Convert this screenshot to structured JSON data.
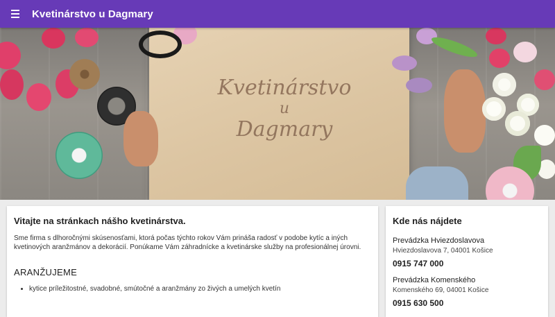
{
  "appbar": {
    "title": "Kvetinárstvo u Dagmary",
    "menu_icon": "menu-icon"
  },
  "hero": {
    "script_line1": "Kvetinárstvo",
    "script_line2": "u",
    "script_line3": "Dagmary",
    "scroll_icon": "mouse-scroll-icon"
  },
  "main": {
    "heading": "Vitajte na stránkach nášho kvetinárstva.",
    "intro": "Sme firma s dlhoročnými skúsenosťami, ktorá počas týchto rokov Vám prináša radosť v podobe kytíc a iných kvetinových aranžmánov a dekorácií. Ponúkame Vám záhradnícke a kvetinárske služby na profesionálnej úrovni.",
    "section_title": "ARANŽUJEME",
    "items": [
      "kytice príležitostné, svadobné, smútočné a aranžmány zo živých a umelých kvetín"
    ]
  },
  "contact": {
    "heading": "Kde nás nájdete",
    "branches": [
      {
        "name": "Prevádzka Hviezdoslavova",
        "address": "Hviezdoslavova 7, 04001 Košice",
        "phone": "0915 747 000"
      },
      {
        "name": "Prevádzka Komenského",
        "address": "Komenského 69, 04001 Košice",
        "phone": "0915 630 500"
      }
    ]
  },
  "colors": {
    "primary": "#673ab7",
    "background": "#ececec"
  }
}
